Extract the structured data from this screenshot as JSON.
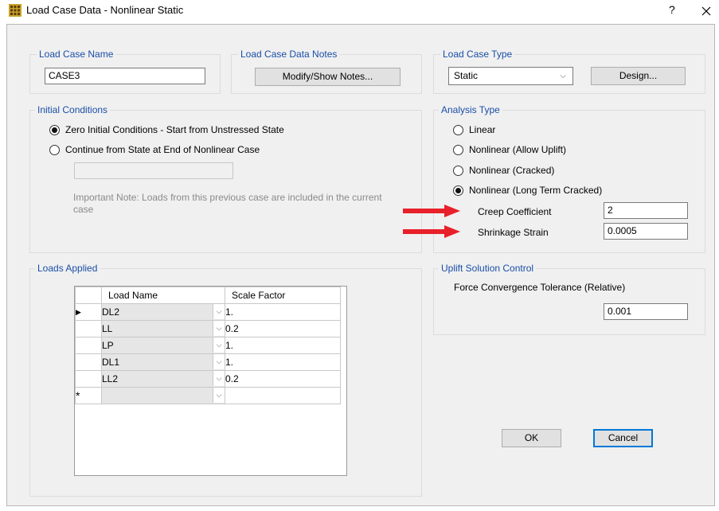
{
  "window": {
    "title": "Load Case Data - Nonlinear Static",
    "help_label": "?",
    "close_label": "×"
  },
  "load_case_name": {
    "legend": "Load Case Name",
    "value": "CASE3"
  },
  "notes": {
    "legend": "Load Case Data Notes",
    "button_label": "Modify/Show Notes..."
  },
  "load_case_type": {
    "legend": "Load Case Type",
    "selected": "Static",
    "design_label": "Design..."
  },
  "initial_conditions": {
    "legend": "Initial Conditions",
    "option_zero": "Zero Initial Conditions - Start from Unstressed State",
    "option_continue": "Continue from State at End of Nonlinear Case",
    "continue_value": "",
    "note": "Important Note:  Loads from this previous case are included in the current case",
    "selected": "zero"
  },
  "analysis_type": {
    "legend": "Analysis Type",
    "options": [
      "Linear",
      "Nonlinear (Allow Uplift)",
      "Nonlinear (Cracked)",
      "Nonlinear (Long Term Cracked)"
    ],
    "selected_index": 3,
    "creep_label": "Creep Coefficient",
    "creep_value": "2",
    "shrinkage_label": "Shrinkage Strain",
    "shrinkage_value": "0.0005",
    "indicator_color": "#e8202a"
  },
  "loads_applied": {
    "legend": "Loads Applied",
    "columns": [
      "Load Name",
      "Scale Factor"
    ],
    "rows": [
      {
        "name": "DL2",
        "scale": "1."
      },
      {
        "name": "LL",
        "scale": "0.2"
      },
      {
        "name": "LP",
        "scale": "1."
      },
      {
        "name": "DL1",
        "scale": "1."
      },
      {
        "name": "LL2",
        "scale": "0.2"
      }
    ],
    "current_row_marker": "▶",
    "new_row_marker": "*"
  },
  "uplift": {
    "legend": "Uplift Solution Control",
    "tolerance_label": "Force Convergence Tolerance (Relative)",
    "tolerance_value": "0.001"
  },
  "footer": {
    "ok_label": "OK",
    "cancel_label": "Cancel"
  },
  "icons": {
    "app": "grid-app-icon",
    "dropdown": "chevron-down-icon"
  }
}
